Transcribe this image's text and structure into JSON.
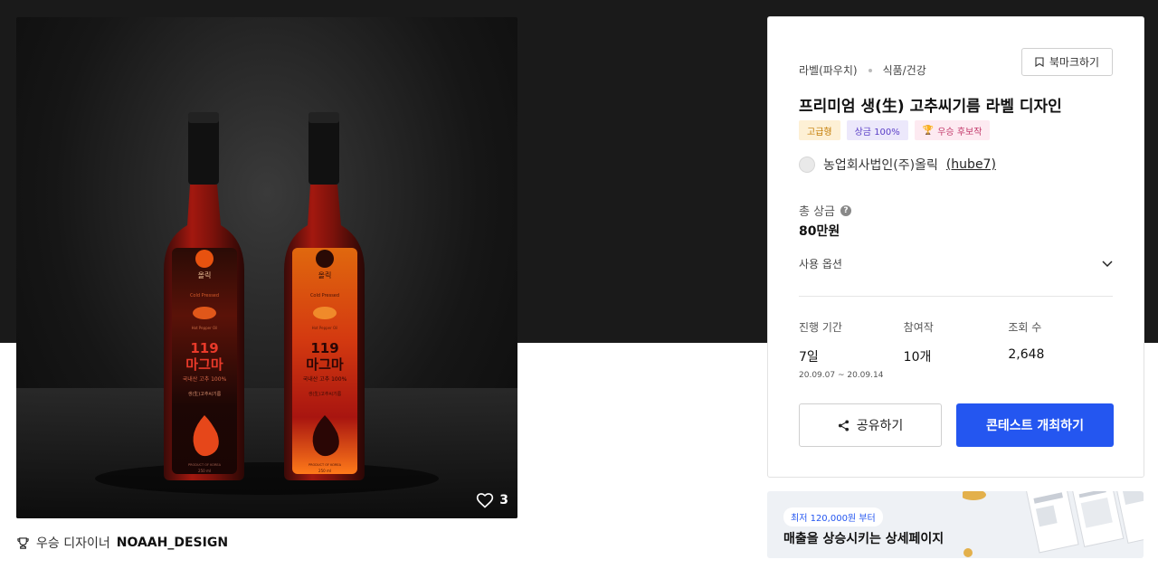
{
  "hero": {
    "likes": "3",
    "label": {
      "brand": "올릭",
      "brand_sub": "Farm EATS",
      "subtitle": "Cold Pressed",
      "caption": "Hot Pepper Oil",
      "number": "119",
      "name": "마그마",
      "origin": "국내산 고추 100%",
      "product": "생(生)고추씨기름",
      "made_in": "PRODUCT OF KOREA",
      "volume": "250 ml"
    }
  },
  "winner": {
    "prefix": "우승 디자이너",
    "name": "NOAAH_DESIGN"
  },
  "card": {
    "breadcrumb": [
      "라벨(파우치)",
      "식품/건강"
    ],
    "bookmark_label": "북마크하기",
    "title": "프리미엄 생(生) 고추씨기름 라벨 디자인",
    "badges": [
      "고급형",
      "상금 100%",
      "우승 후보작"
    ],
    "company": "농업회사법인(주)올릭",
    "handle": "(hube7)",
    "prize_label": "총 상금",
    "prize_help": "?",
    "prize_value": "80만원",
    "option_label": "사용 옵션",
    "stats": [
      {
        "label": "진행 기간",
        "value": "7일",
        "sub": "20.09.07  ~  20.09.14"
      },
      {
        "label": "참여작",
        "value": "10개",
        "sub": ""
      },
      {
        "label": "조회 수",
        "value": "2,648",
        "sub": ""
      }
    ],
    "share_label": "공유하기",
    "host_label": "콘테스트 개최하기"
  },
  "ad": {
    "pill": "최저 120,000원 부터",
    "headline": "매출을 상승시키는 상세페이지"
  },
  "colors": {
    "accent": "#2456f0",
    "dark_band": "#1a1a1a"
  }
}
